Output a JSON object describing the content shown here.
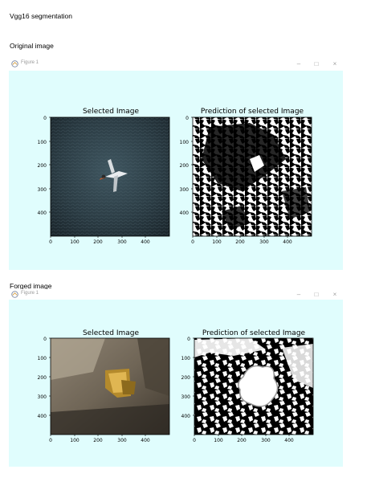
{
  "page": {
    "title": "Vgg16 segmentation",
    "original_heading": "Original image",
    "forged_heading": "Forged image"
  },
  "window": {
    "title": "Figure 1",
    "minimize_glyph": "–",
    "maximize_glyph": "□",
    "close_glyph": "×",
    "background": "#e0fdfd"
  },
  "figures": [
    {
      "left_title": "Selected Image",
      "right_title": "Prediction of selected Image"
    },
    {
      "left_title": "Selected Image",
      "right_title": "Prediction of selected Image"
    }
  ],
  "axes": {
    "x_ticks": [
      "0",
      "100",
      "200",
      "300",
      "400"
    ],
    "y_ticks": [
      "0",
      "100",
      "200",
      "300",
      "400"
    ]
  }
}
